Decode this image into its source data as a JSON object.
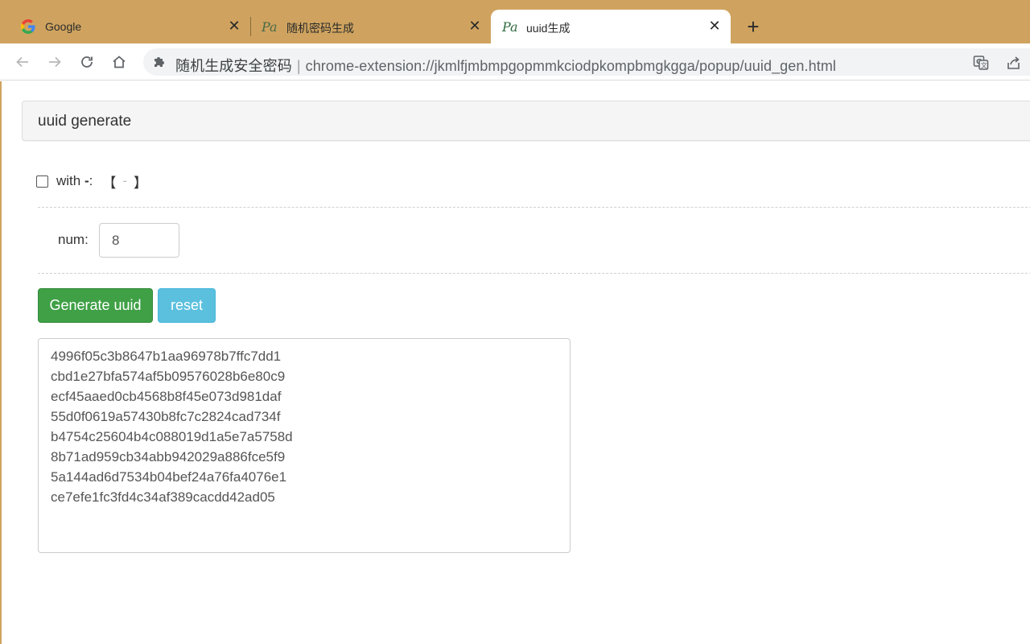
{
  "browser": {
    "tabs": [
      {
        "title": "Google",
        "icon": "google-icon",
        "active": false
      },
      {
        "title": "随机密码生成",
        "icon": "pa-logo-icon",
        "active": false
      },
      {
        "title": "uuid生成",
        "icon": "pa-logo-icon",
        "active": true
      }
    ],
    "newtab_label": "+",
    "omnibox": {
      "site_name": "随机生成安全密码",
      "separator": "|",
      "url": "chrome-extension://jkmlfjmbmpgopmmkciodpkompbmgkgga/popup/uuid_gen.html"
    },
    "colors": {
      "frame": "#cfa35f",
      "omnibox_bg": "#f1f3f4"
    }
  },
  "panel": {
    "title": "uuid generate"
  },
  "options": {
    "with_label": "with",
    "with_dash": "-",
    "with_colon": ":",
    "bracket_open": "【",
    "bracket_hint": "-",
    "bracket_close": "】",
    "with_checked": false
  },
  "num": {
    "label": "num:",
    "value": "8"
  },
  "buttons": {
    "generate": "Generate uuid",
    "reset": "reset",
    "generate_color": "#3fa046",
    "reset_color": "#5bc0de"
  },
  "output": {
    "uuids": [
      "4996f05c3b8647b1aa96978b7ffc7dd1",
      "cbd1e27bfa574af5b09576028b6e80c9",
      "ecf45aaed0cb4568b8f45e073d981daf",
      "55d0f0619a57430b8fc7c2824cad734f",
      "b4754c25604b4c088019d1a5e7a5758d",
      "8b71ad959cb34abb942029a886fce5f9",
      "5a144ad6d7534b04bef24a76fa4076e1",
      "ce7efe1fc3fd4c34af389cacdd42ad05"
    ]
  }
}
